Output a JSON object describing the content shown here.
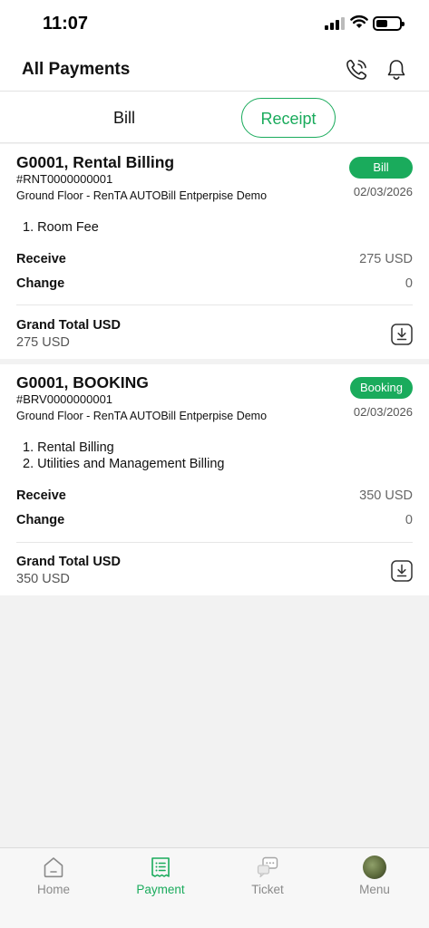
{
  "status_bar": {
    "time": "11:07"
  },
  "header": {
    "title": "All Payments",
    "phone_icon": "phone-ring-icon",
    "bell_icon": "bell-icon"
  },
  "tabs": [
    {
      "label": "Bill",
      "active": false
    },
    {
      "label": "Receipt",
      "active": true
    }
  ],
  "accent_color": "#1aab5c",
  "payments": [
    {
      "title": "G0001, Rental Billing",
      "ref": "#RNT0000000001",
      "location": "Ground Floor - RenTA AUTOBill Entperpise Demo",
      "badge": "Bill",
      "date": "02/03/2026",
      "items": [
        "1. Room Fee"
      ],
      "receive_label": "Receive",
      "receive_value": "275 USD",
      "change_label": "Change",
      "change_value": "0",
      "grand_total_label": "Grand Total USD",
      "grand_total_value": "275 USD"
    },
    {
      "title": "G0001, BOOKING",
      "ref": "#BRV0000000001",
      "location": "Ground Floor - RenTA AUTOBill Entperpise Demo",
      "badge": "Booking",
      "date": "02/03/2026",
      "items": [
        "1. Rental Billing",
        "2. Utilities and Management Billing"
      ],
      "receive_label": "Receive",
      "receive_value": "350 USD",
      "change_label": "Change",
      "change_value": "0",
      "grand_total_label": "Grand Total USD",
      "grand_total_value": "350 USD"
    }
  ],
  "bottom_nav": [
    {
      "label": "Home",
      "icon": "home-icon",
      "active": false
    },
    {
      "label": "Payment",
      "icon": "receipt-list-icon",
      "active": true
    },
    {
      "label": "Ticket",
      "icon": "chat-ticket-icon",
      "active": false
    },
    {
      "label": "Menu",
      "icon": "avatar",
      "active": false
    }
  ]
}
